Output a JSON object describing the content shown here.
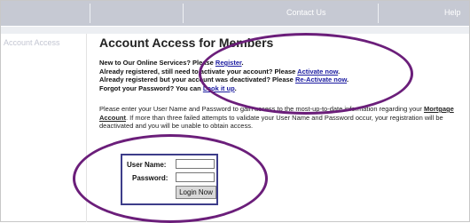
{
  "nav": {
    "contact_label": "Contact Us",
    "help_label": "Help"
  },
  "sidebar": {
    "account_access_label": "Account Access"
  },
  "main": {
    "title": "Account Access for Members",
    "links": [
      {
        "text": "New to Our Online Services? Please",
        "link": "Register",
        "suffix": "."
      },
      {
        "text": "Already registered, still need to activate your account? Please",
        "link": "Activate now",
        "suffix": "."
      },
      {
        "text": "Already registered but your account was deactivated? Please",
        "link": "Re-Activate now",
        "suffix": "."
      },
      {
        "text": "Forgot your Password? You can",
        "link": "Look it up",
        "suffix": "."
      }
    ],
    "instructions": {
      "before": "Please enter your User Name and Password to gain access to the most-up-to-date information regarding your",
      "bold": "Mortgage Account",
      "after": ". If more than three failed attempts to validate your User Name and Password occur, your registration will be deactivated and you will be unable to obtain access."
    }
  },
  "login": {
    "username_label": "User Name:",
    "password_label": "Password:",
    "submit_label": "Login Now"
  },
  "colors": {
    "annotation_ellipse": "#6b1e7a",
    "link": "#1a1aa0",
    "topbar": "#c6c9d3"
  }
}
